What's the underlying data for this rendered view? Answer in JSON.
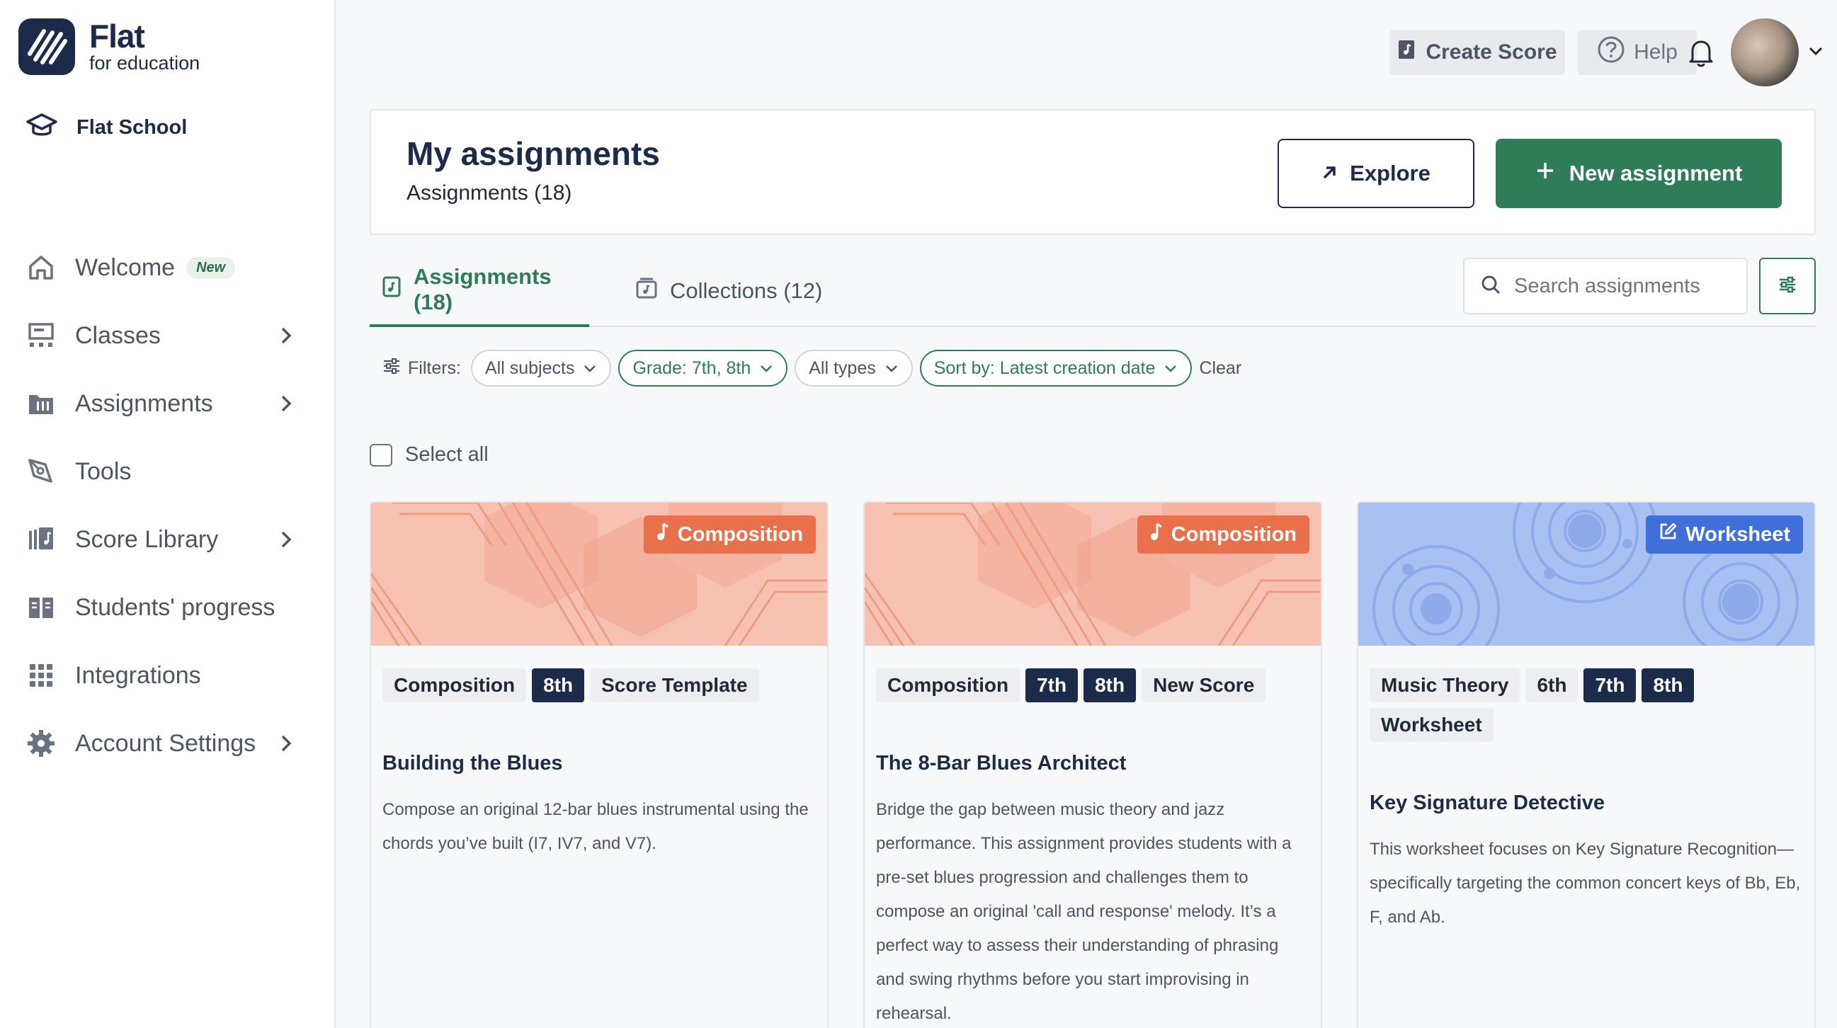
{
  "brand": {
    "title": "Flat",
    "subtitle": "for education",
    "school": "Flat School"
  },
  "sidebar": {
    "items": [
      {
        "label": "Welcome",
        "badge": "New",
        "icon": "home-icon"
      },
      {
        "label": "Classes",
        "icon": "classes-icon",
        "has_submenu": true
      },
      {
        "label": "Assignments",
        "icon": "assignments-icon",
        "has_submenu": true
      },
      {
        "label": "Tools",
        "icon": "tools-icon"
      },
      {
        "label": "Score Library",
        "icon": "library-icon",
        "has_submenu": true
      },
      {
        "label": "Students' progress",
        "icon": "progress-icon"
      },
      {
        "label": "Integrations",
        "icon": "grid-icon"
      },
      {
        "label": "Account Settings",
        "icon": "gear-icon",
        "has_submenu": true
      }
    ]
  },
  "topbar": {
    "create_score": "Create Score",
    "help": "Help"
  },
  "header": {
    "title": "My assignments",
    "subtitle": "Assignments (18)",
    "explore": "Explore",
    "new_assignment": "New assignment"
  },
  "tabs": [
    {
      "label": "Assignments (18)",
      "active": true
    },
    {
      "label": "Collections (12)",
      "active": false
    }
  ],
  "search": {
    "placeholder": "Search assignments"
  },
  "filters": {
    "label": "Filters:",
    "subjects": "All subjects",
    "grade": "Grade: 7th, 8th",
    "types": "All types",
    "sort": "Sort by: Latest creation date",
    "clear": "Clear"
  },
  "select_all": "Select all",
  "cards": [
    {
      "type": "Composition",
      "tags": [
        "Composition",
        "8th",
        "Score Template"
      ],
      "title": "Building the Blues",
      "description": "Compose an original 12-bar blues instrumental using the chords you’ve built (I7, IV7, and V7)."
    },
    {
      "type": "Composition",
      "tags": [
        "Composition",
        "7th",
        "8th",
        "New Score"
      ],
      "title": "The 8-Bar Blues Architect",
      "description": "Bridge the gap between music theory and jazz performance. This assignment provides students with a pre-set blues progression and challenges them to compose an original 'call and response' melody. It’s a perfect way to assess their understanding of phrasing and swing rhythms before you start improvising in rehearsal."
    },
    {
      "type": "Worksheet",
      "tags": [
        "Music Theory",
        "6th",
        "7th",
        "8th",
        "Worksheet"
      ],
      "title": "Key Signature Detective",
      "description": "This worksheet focuses on Key Signature Recognition—specifically targeting the common concert keys of Bb, Eb, F, and Ab."
    }
  ],
  "colors": {
    "accent": "#2f7d58",
    "navy": "#1c2b4a",
    "composition": "#e8704a",
    "worksheet": "#3f6fd9"
  }
}
